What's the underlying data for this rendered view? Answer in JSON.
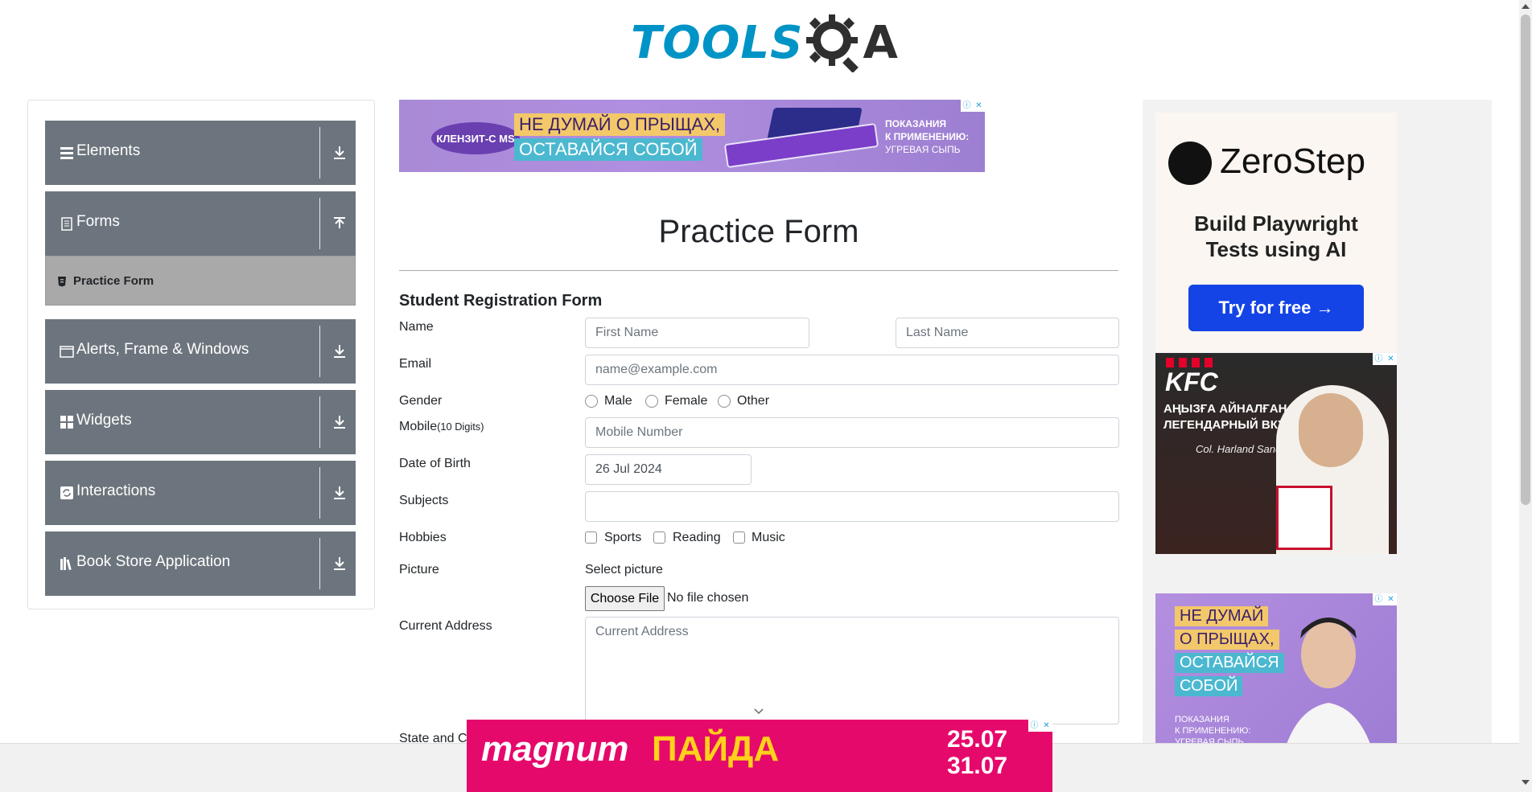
{
  "logo": {
    "text_tools": "TOOLS",
    "text_a": "A"
  },
  "sidebar": {
    "groups": [
      {
        "label": "Elements",
        "icon": "menu-icon",
        "arrow": "download-icon"
      },
      {
        "label": "Forms",
        "icon": "file-icon",
        "arrow": "upload-icon"
      },
      {
        "label": "Alerts, Frame & Windows",
        "icon": "window-icon",
        "arrow": "download-icon"
      },
      {
        "label": "Widgets",
        "icon": "grid-icon",
        "arrow": "download-icon"
      },
      {
        "label": "Interactions",
        "icon": "refresh-icon",
        "arrow": "download-icon"
      },
      {
        "label": "Book Store Application",
        "icon": "books-icon",
        "arrow": "download-icon"
      }
    ],
    "active_item": {
      "label": "Practice Form",
      "icon": "html-file-icon"
    }
  },
  "ad_top": {
    "brand": "КЛЕНЗИТ-С MS",
    "line1": "НЕ ДУМАЙ О ПРЫЩАХ,",
    "line2": "ОСТАВАЙСЯ СОБОЙ",
    "side1": "ПОКАЗАНИЯ",
    "side2": "К ПРИМЕНЕНИЮ:",
    "side3": "УГРЕВАЯ СЫПЬ"
  },
  "form": {
    "title": "Practice Form",
    "subtitle": "Student Registration Form",
    "labels": {
      "name": "Name",
      "email": "Email",
      "gender": "Gender",
      "mobile": "Mobile",
      "mobile_hint": "(10 Digits)",
      "dob": "Date of Birth",
      "subjects": "Subjects",
      "hobbies": "Hobbies",
      "picture": "Picture",
      "address": "Current Address",
      "state_city": "State and City"
    },
    "placeholders": {
      "first_name": "First Name",
      "last_name": "Last Name",
      "email": "name@example.com",
      "mobile": "Mobile Number",
      "address": "Current Address"
    },
    "dob_value": "26 Jul 2024",
    "gender_options": [
      "Male",
      "Female",
      "Other"
    ],
    "hobby_options": [
      "Sports",
      "Reading",
      "Music"
    ],
    "picture_caption": "Select picture",
    "file_button": "Choose File",
    "file_status": "No file chosen"
  },
  "ad_right": {
    "zerostep_name": "ZeroStep",
    "zerostep_tag1": "Build Playwright",
    "zerostep_tag2": "Tests using AI",
    "zerostep_button": "Try for free →",
    "kfc_brand": "KFC",
    "kfc_line1": "АҢЫЗҒА АЙНАЛҒАН ДӘМ",
    "kfc_line2": "ЛЕГЕНДАРНЫЙ ВКУС",
    "kfc_signature": "Col. Harland Sanders",
    "purple_words": [
      "НЕ ДУМАЙ",
      "О ПРЫЩАХ,",
      "ОСТАВАЙСЯ",
      "СОБОЙ"
    ],
    "purple_side1": "ПОКАЗАНИЯ",
    "purple_side2": "К ПРИМЕНЕНИЮ:",
    "purple_side3": "УГРЕВАЯ СЫПЬ"
  },
  "ad_bottom": {
    "brand": "magnum",
    "promo": "ПАЙДА",
    "date1": "25.07",
    "date2": "31.07"
  },
  "colors": {
    "sidebar_group": "#6c757d",
    "sidebar_active": "#a9a9a9",
    "logo_blue": "#0094c6",
    "zerostep_button": "#1544e6",
    "magnum_pink": "#e5096b"
  }
}
